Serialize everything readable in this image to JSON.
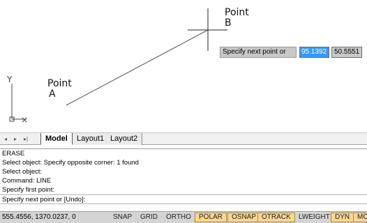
{
  "canvas": {
    "point_b": {
      "line1": "Point",
      "line2": "B"
    },
    "point_a": {
      "line1": "Point",
      "line2": "A"
    },
    "ucs": {
      "y_label": "Y",
      "x_label": "×"
    },
    "dynamic_input": {
      "prompt": "Specify next point or",
      "field1": "95.1392",
      "field2": "50.5551"
    }
  },
  "tabs": {
    "nav": [
      "◂",
      "▸",
      "▸|"
    ],
    "items": [
      "Model",
      "Layout1",
      "Layout2"
    ],
    "active": "Model"
  },
  "command_history": [
    "ERASE",
    "Select object: Specify opposite corner: 1 found",
    "Select object:",
    "Command: LINE",
    "Specify first point:"
  ],
  "command_prompt": "Specify next point or [Undo]:",
  "status_bar": {
    "coordinates": "555.4556, 1370.0237, 0",
    "buttons": [
      {
        "label": "SNAP",
        "on": false
      },
      {
        "label": "GRID",
        "on": false
      },
      {
        "label": "ORTHO",
        "on": false
      },
      {
        "label": "POLAR",
        "on": true
      },
      {
        "label": "OSNAP",
        "on": true
      },
      {
        "label": "OTRACK",
        "on": true
      },
      {
        "label": "LWEIGHT",
        "on": false
      },
      {
        "label": "DYN",
        "on": true
      },
      {
        "label": "MO",
        "on": true
      }
    ]
  },
  "colors": {
    "toggle_on": "#f7d98a",
    "highlight": "#3399ff",
    "canvas": "#ffffff"
  }
}
